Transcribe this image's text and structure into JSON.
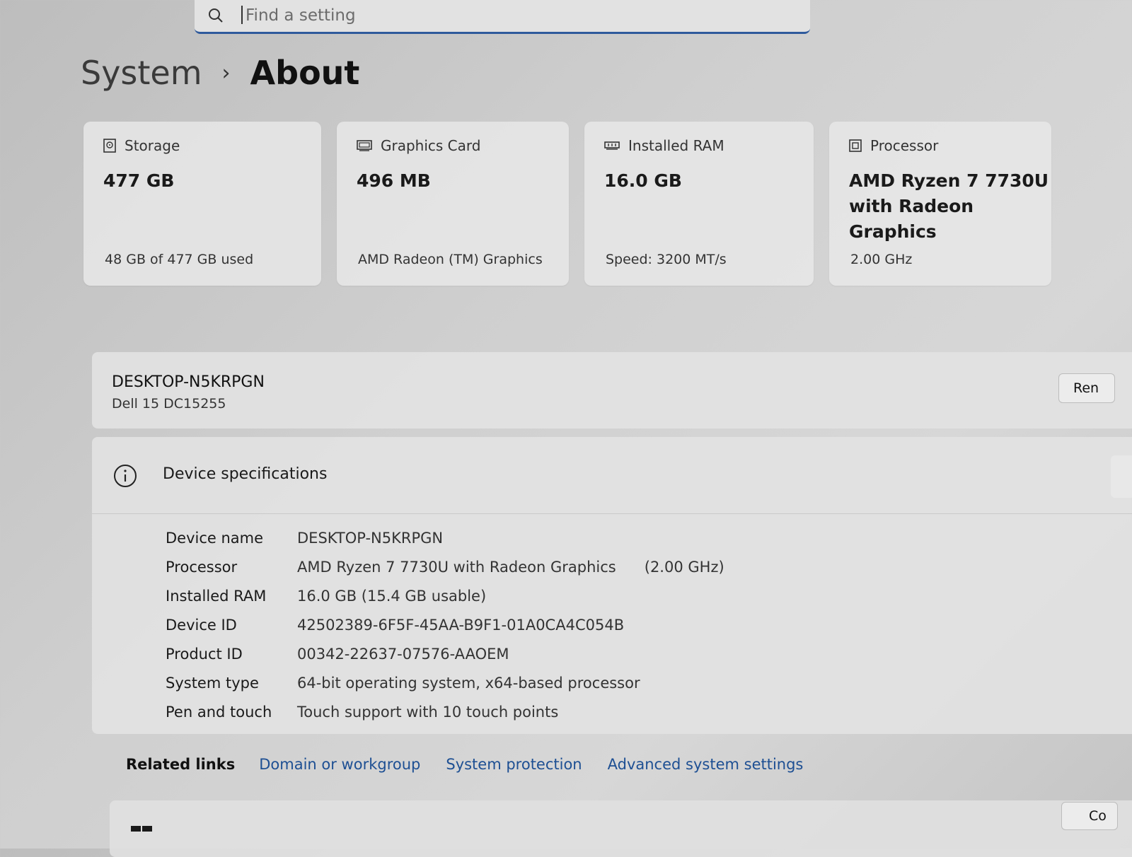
{
  "search": {
    "placeholder": "Find a setting"
  },
  "breadcrumb": {
    "root": "System",
    "separator": "›",
    "current": "About"
  },
  "cards": [
    {
      "icon": "storage-icon",
      "label": "Storage",
      "value": "477 GB",
      "sub": "48 GB of 477 GB used"
    },
    {
      "icon": "graphics-card-icon",
      "label": "Graphics Card",
      "value": "496 MB",
      "sub": "AMD Radeon (TM) Graphics"
    },
    {
      "icon": "ram-icon",
      "label": "Installed RAM",
      "value": "16.0 GB",
      "sub": "Speed: 3200 MT/s"
    },
    {
      "icon": "processor-icon",
      "label": "Processor",
      "value": "AMD Ryzen 7 7730U with Radeon Graphics",
      "sub": "2.00 GHz"
    }
  ],
  "device": {
    "name": "DESKTOP-N5KRPGN",
    "model": "Dell 15 DC15255",
    "rename_label": "Ren"
  },
  "specs": {
    "title": "Device specifications",
    "rows": [
      {
        "key": "Device name",
        "value": "DESKTOP-N5KRPGN"
      },
      {
        "key": "Processor",
        "value": "AMD Ryzen 7 7730U with Radeon Graphics      (2.00 GHz)"
      },
      {
        "key": "Installed RAM",
        "value": "16.0 GB (15.4 GB usable)"
      },
      {
        "key": "Device ID",
        "value": "42502389-6F5F-45AA-B9F1-01A0CA4C054B"
      },
      {
        "key": "Product ID",
        "value": "00342-22637-07576-AAOEM"
      },
      {
        "key": "System type",
        "value": "64-bit operating system, x64-based processor"
      },
      {
        "key": "Pen and touch",
        "value": "Touch support with 10 touch points"
      }
    ]
  },
  "related": {
    "label": "Related links",
    "links": [
      "Domain or workgroup",
      "System protection",
      "Advanced system settings"
    ]
  },
  "bottom": {
    "copy_label": "Co"
  },
  "colors": {
    "accent": "#2f5a9c",
    "link": "#1d4f93"
  }
}
